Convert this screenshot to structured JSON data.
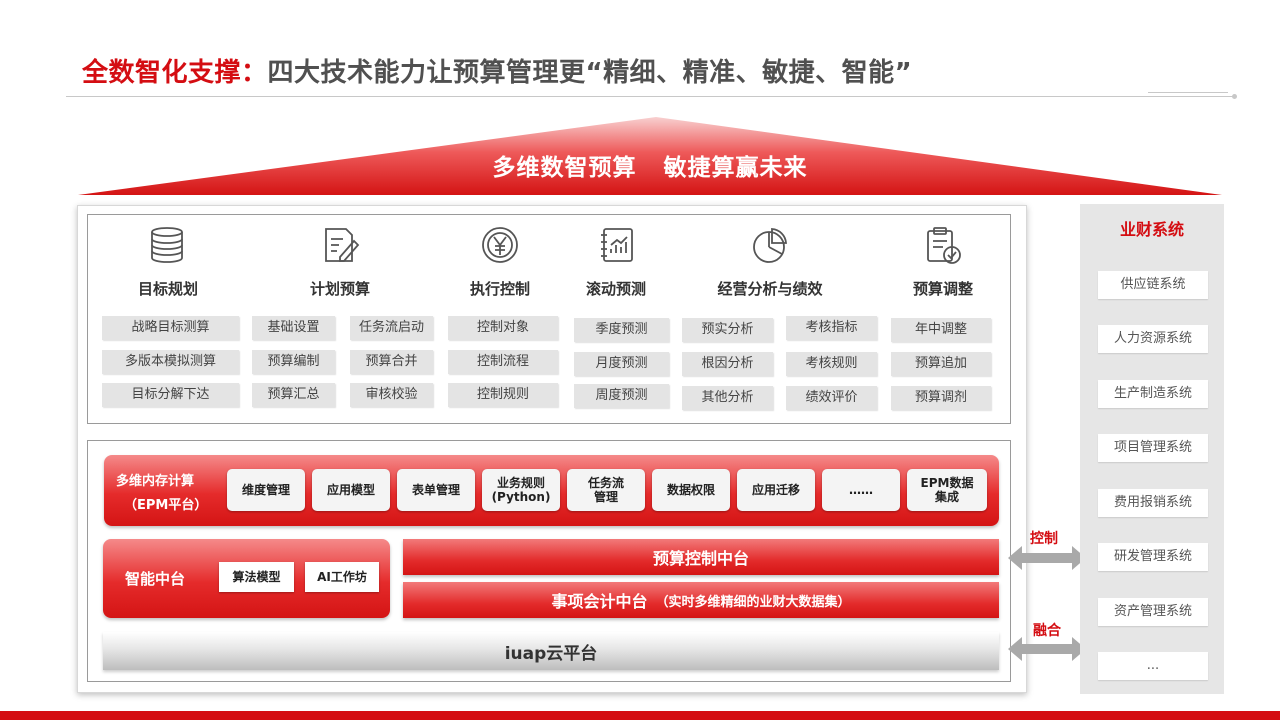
{
  "header": {
    "title_red": "全数智化支撑：",
    "title_gray": "四大技术能力让预算管理更“精细、精准、敏捷、智能”"
  },
  "roof": {
    "slogan": "多维数智预算   敏捷算赢未来"
  },
  "modules": [
    {
      "title": "目标规划",
      "icon": "database-icon",
      "items": [
        "战略目标测算",
        "多版本模拟测算",
        "目标分解下达"
      ]
    },
    {
      "title": "计划预算",
      "icon": "edit-document-icon",
      "items": [
        "基础设置",
        "任务流启动",
        "预算编制",
        "预算合并",
        "预算汇总",
        "审核校验"
      ]
    },
    {
      "title": "执行控制",
      "icon": "yen-coin-icon",
      "items": [
        "控制对象",
        "控制流程",
        "控制规则"
      ]
    },
    {
      "title": "滚动预测",
      "icon": "chart-notebook-icon",
      "items": [
        "季度预测",
        "月度预测",
        "周度预测"
      ]
    },
    {
      "title": "经营分析与绩效",
      "icon": "pie-chart-icon",
      "items": [
        "预实分析",
        "考核指标",
        "根因分析",
        "考核规则",
        "其他分析",
        "绩效评价"
      ]
    },
    {
      "title": "预算调整",
      "icon": "clipboard-check-icon",
      "items": [
        "年中调整",
        "预算追加",
        "预算调剂"
      ]
    }
  ],
  "epm": {
    "label_line1": "多维内存计算",
    "label_line2": "（EPM平台）",
    "buttons": [
      "维度管理",
      "应用模型",
      "表单管理",
      "业务规则\n(Python)",
      "任务流\n管理",
      "数据权限",
      "应用迁移",
      "……",
      "EPM数据\n集成"
    ]
  },
  "ai": {
    "label": "智能中台",
    "buttons": [
      "算法模型",
      "AI工作坊"
    ]
  },
  "platforms": {
    "budget_control": "预算控制中台",
    "accounting": "事项会计中台",
    "accounting_sub": "（实时多维精细的业财大数据集）",
    "iuap": "iuap云平台"
  },
  "arrows": {
    "control": "控制",
    "fusion": "融合"
  },
  "side": {
    "title": "业财系统",
    "items": [
      "供应链系统",
      "人力资源系统",
      "生产制造系统",
      "项目管理系统",
      "费用报销系统",
      "研发管理系统",
      "资产管理系统",
      "..."
    ]
  },
  "colors": {
    "brand_red": "#d40d12",
    "panel_gray": "#e6e6e6",
    "chip_gray": "#e4e4e4"
  }
}
